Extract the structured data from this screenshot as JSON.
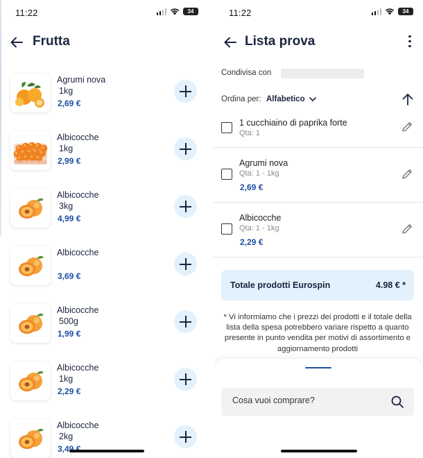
{
  "left": {
    "status_time": "11:22",
    "battery": "34",
    "title": "Frutta",
    "products": [
      {
        "name": "Agrumi nova",
        "qty": "1kg",
        "price": "2,69 €",
        "image": "citrus"
      },
      {
        "name": "Albicocche",
        "qty": "1kg",
        "price": "2,99 €",
        "image": "apricot-basket"
      },
      {
        "name": "Albicocche",
        "qty": "3kg",
        "price": "4,99 €",
        "image": "apricot"
      },
      {
        "name": "Albicocche",
        "qty": "",
        "price": "3,69 €",
        "image": "apricot"
      },
      {
        "name": "Albicocche",
        "qty": "500g",
        "price": "1,99 €",
        "image": "apricot"
      },
      {
        "name": "Albicocche",
        "qty": "1kg",
        "price": "2,29 €",
        "image": "apricot"
      },
      {
        "name": "Albicocche",
        "qty": "2kg",
        "price": "3,49 €",
        "image": "apricot"
      }
    ]
  },
  "right": {
    "status_time": "11:22",
    "battery": "34",
    "title": "Lista prova",
    "shared_with": "Condivisa con",
    "sort_label": "Ordina per:",
    "sort_value": "Alfabetico",
    "items": [
      {
        "name": "1 cucchiaino di paprika forte",
        "qty": "Qta: 1",
        "price": ""
      },
      {
        "name": "Agrumi nova",
        "qty": "Qta: 1 - 1kg",
        "price": "2,69 €"
      },
      {
        "name": "Albicocche",
        "qty": "Qta: 1 - 1kg",
        "price": "2,29 €"
      }
    ],
    "total_label": "Totale prodotti Eurospin",
    "total_value": "4.98 € *",
    "disclaimer": "* Vi informiamo che i prezzi dei prodotti e il totale della lista della spesa potrebbero variare rispetto a quanto presente in punto vendita per motivi di assortimento e aggiornamento prodotti",
    "search_placeholder": "Cosa vuoi comprare?"
  },
  "colors": {
    "accent_blue": "#1e4fa3",
    "title_navy": "#1b2440",
    "light_blue": "#e2f1fb"
  },
  "icons": [
    "back-arrow-icon",
    "plus-icon",
    "kebab-menu-icon",
    "chevron-down-icon",
    "sort-arrow-up-icon",
    "checkbox-icon",
    "pencil-icon",
    "search-icon"
  ]
}
